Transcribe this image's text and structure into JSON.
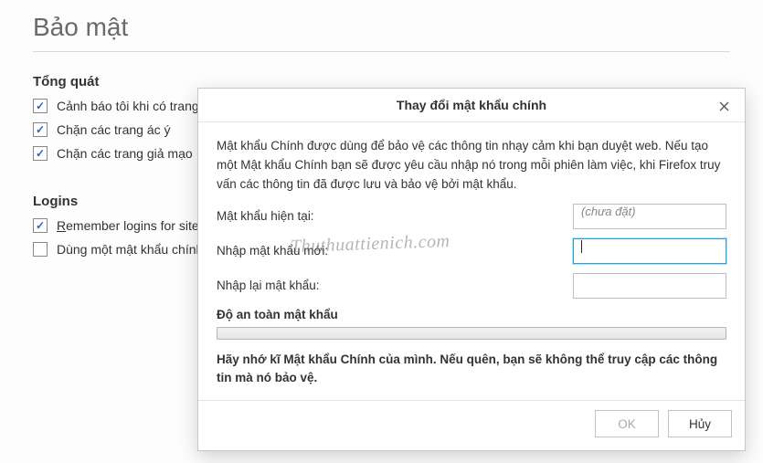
{
  "page": {
    "title": "Bảo mật"
  },
  "general": {
    "heading": "Tổng quát",
    "items": [
      {
        "label": "Cảnh báo tôi khi có trang web cố cài đặt tiện ích",
        "checked": true
      },
      {
        "label": "Chặn các trang ác ý",
        "checked": true
      },
      {
        "label": "Chặn các trang giả mạo",
        "checked": true
      }
    ]
  },
  "logins": {
    "heading": "Logins",
    "items": [
      {
        "label": "Remember logins for sites",
        "checked": true,
        "underline": true
      },
      {
        "label": "Dùng một mật khẩu chính",
        "checked": false
      }
    ]
  },
  "dialog": {
    "title": "Thay đổi mật khẩu chính",
    "description": "Mật khẩu Chính được dùng để bảo vệ các thông tin nhạy cảm khi bạn duyệt web. Nếu tạo một Mật khẩu Chính bạn sẽ được yêu cầu nhập nó trong mỗi phiên làm việc, khi Firefox truy vấn các thông tin đã được lưu và bảo vệ bởi mật khẩu.",
    "fields": {
      "current_label": "Mật khẩu hiện tại:",
      "current_placeholder": "(chưa đặt)",
      "new_label": "Nhập mật khẩu mới:",
      "confirm_label": "Nhập lại mật khẩu:"
    },
    "meter_label": "Độ an toàn mật khẩu",
    "warning": "Hãy nhớ kĩ Mật khẩu Chính của mình. Nếu quên, bạn sẽ không thể truy cập các thông tin mà nó bảo vệ.",
    "ok_label": "OK",
    "cancel_label": "Hủy"
  },
  "watermark": "Thuthuattienich.com"
}
